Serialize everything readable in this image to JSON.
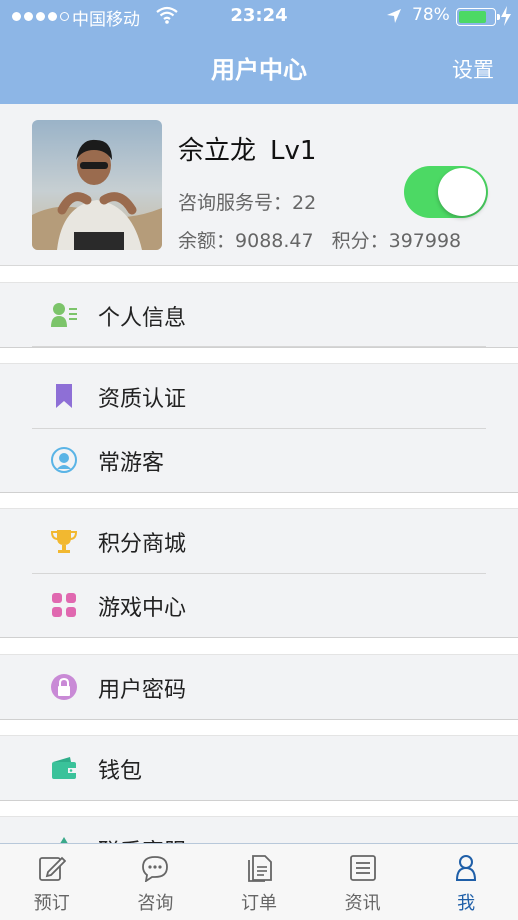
{
  "status_bar": {
    "carrier": "中国移动",
    "time": "23:24",
    "battery_percent": "78%",
    "battery_level": 0.78
  },
  "nav": {
    "title": "用户中心",
    "settings_label": "设置"
  },
  "profile": {
    "name": "佘立龙",
    "level": "Lv1",
    "service_label": "咨询服务号：",
    "service_number": "22",
    "balance_label": "余额：",
    "balance": "9088.47",
    "points_label": "积分：",
    "points": "397998",
    "toggle_on": true
  },
  "menu": {
    "personal_info": "个人信息",
    "qualification": "资质认证",
    "frequent_traveler": "常游客",
    "points_mall": "积分商城",
    "game_center": "游戏中心",
    "user_password": "用户密码",
    "wallet": "钱包",
    "contact_service": "联系客服"
  },
  "tabs": {
    "book": "预订",
    "consult": "咨询",
    "orders": "订单",
    "news": "资讯",
    "me": "我"
  },
  "colors": {
    "nav_bar": "#8db6e6",
    "toggle_on": "#4cd964",
    "active_tab": "#1f5fa8"
  }
}
